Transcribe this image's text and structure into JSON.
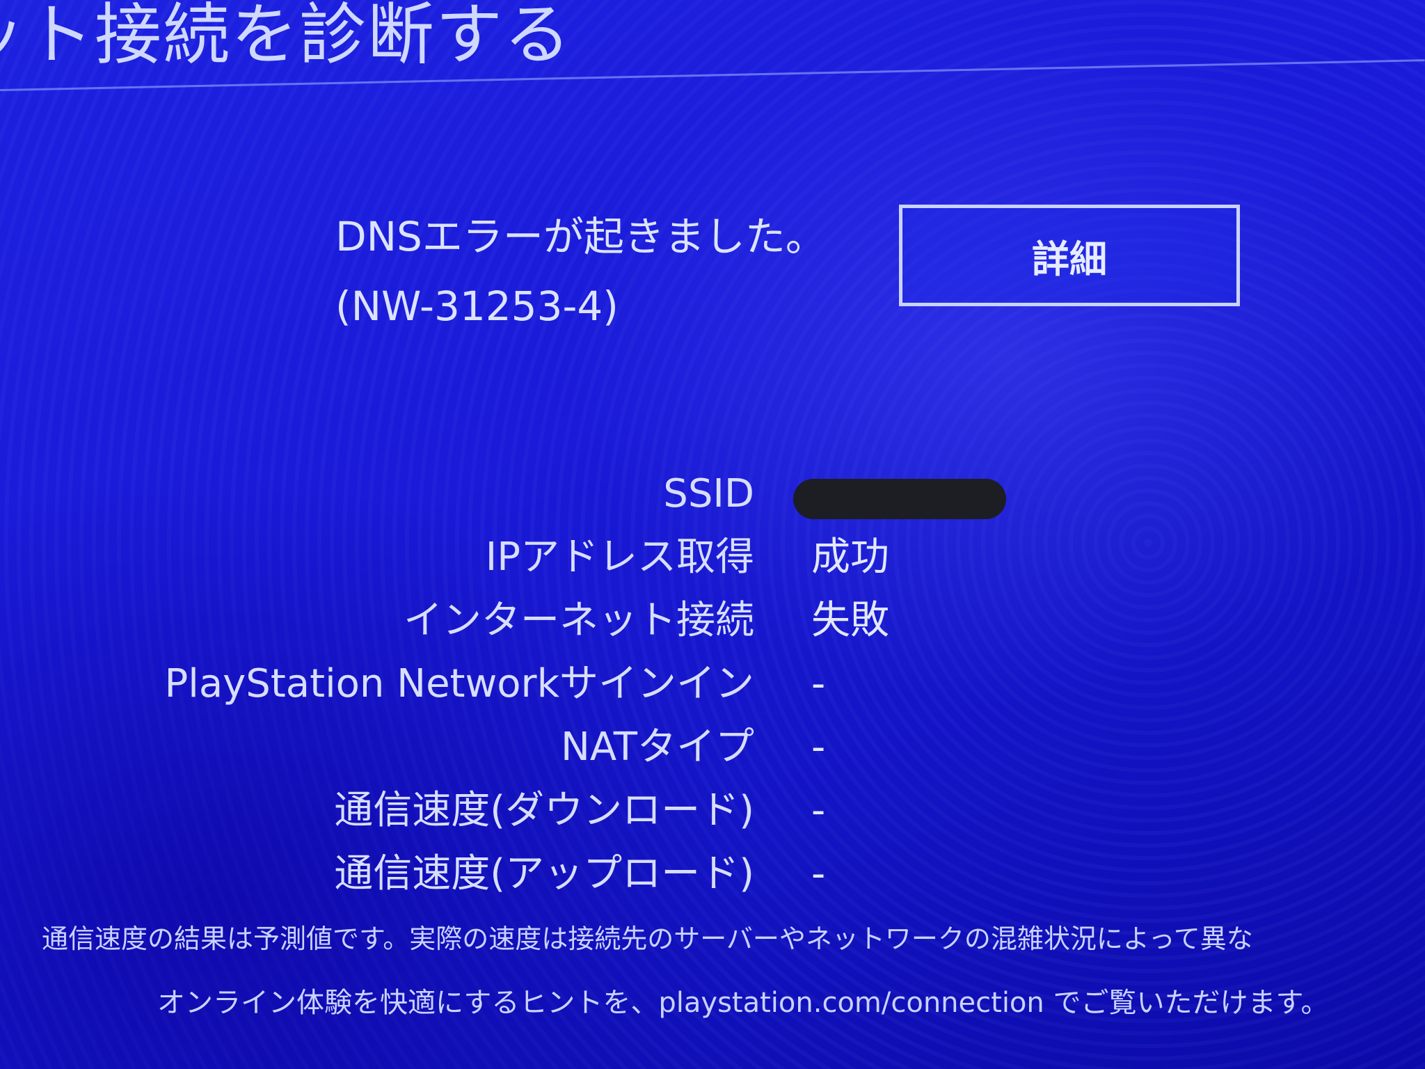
{
  "header": {
    "title": "ット接続を診断する"
  },
  "error": {
    "message": "DNSエラーが起きました。",
    "code": "(NW-31253-4)"
  },
  "details_button": {
    "label": "詳細"
  },
  "results": [
    {
      "label": "SSID",
      "value": ""
    },
    {
      "label": "IPアドレス取得",
      "value": "成功"
    },
    {
      "label": "インターネット接続",
      "value": "失敗"
    },
    {
      "label": "PlayStation Networkサインイン",
      "value": "-"
    },
    {
      "label": "NATタイプ",
      "value": "-"
    },
    {
      "label": "通信速度(ダウンロード)",
      "value": "-"
    },
    {
      "label": "通信速度(アップロード)",
      "value": "-"
    }
  ],
  "footnotes": {
    "speed_note": "通信速度の結果は予測値です。実際の速度は接続先のサーバーやネットワークの混雑状況によって異な",
    "hint": "オンライン体験を快適にするヒントを、playstation.com/connection でご覧いただけます。"
  },
  "colors": {
    "background": "#1a1ad8",
    "text": "#dfe6ff",
    "button_border": "#c9d3ff",
    "redaction": "#1d1d24"
  }
}
